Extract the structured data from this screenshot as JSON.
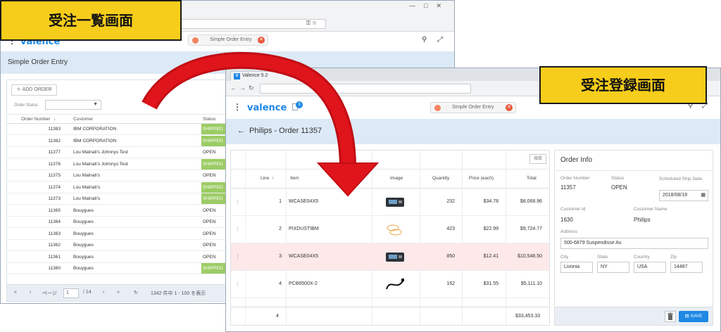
{
  "callouts": {
    "list_screen": "受注一覧画面",
    "entry_screen": "受注登録画面"
  },
  "list_window": {
    "app_logo": "valence",
    "open_tab": "Simple Order Entry",
    "page_title": "Simple Order Entry",
    "add_order_label": "ADD ORDER",
    "filter_label": "Order Status",
    "columns": {
      "order_number": "Order Number",
      "customer": "Customer",
      "status": "Status"
    },
    "rows": [
      {
        "num": "11383",
        "cust": "IBM CORPORATION",
        "status": "SHIPPED"
      },
      {
        "num": "11382",
        "cust": "IBM CORPORATION",
        "status": "SHIPPED"
      },
      {
        "num": "11377",
        "cust": "Lou Malnati's Johnnys Test",
        "status": "OPEN"
      },
      {
        "num": "11376",
        "cust": "Lou Malnati's Johnnys Test",
        "status": "SHIPPED"
      },
      {
        "num": "11375",
        "cust": "Lou Malnati's",
        "status": "OPEN"
      },
      {
        "num": "11374",
        "cust": "Lou Malnati's",
        "status": "SHIPPED"
      },
      {
        "num": "11373",
        "cust": "Lou Malnati's",
        "status": "SHIPPED"
      },
      {
        "num": "11365",
        "cust": "Bouygues",
        "status": "OPEN"
      },
      {
        "num": "11364",
        "cust": "Bouygues",
        "status": "OPEN"
      },
      {
        "num": "11363",
        "cust": "Bouygues",
        "status": "OPEN"
      },
      {
        "num": "11362",
        "cust": "Bouygues",
        "status": "OPEN"
      },
      {
        "num": "11361",
        "cust": "Bouygues",
        "status": "OPEN"
      },
      {
        "num": "11360",
        "cust": "Bouygues",
        "status": "SHIPPED"
      }
    ],
    "pager": {
      "page_label": "ページ",
      "page": "1",
      "of_pages": "/ 14",
      "summary": "1342 件中 1 - 100 を表示"
    }
  },
  "entry_window": {
    "browser_tab": "Valence 5.2",
    "app_logo": "valence",
    "badge_count": "3",
    "open_tab": "Simple Order Entry",
    "page_title": "Philips - Order 11357",
    "columns_button": "項目",
    "columns": {
      "line": "Line",
      "item": "Item",
      "image": "Image",
      "quantity": "Quantity",
      "price": "Price (each)",
      "total": "Total"
    },
    "lines": [
      {
        "line": "1",
        "item": "WCASE04X5",
        "qty": "232",
        "price": "$34.78",
        "total": "$8,068.96",
        "img": "device"
      },
      {
        "line": "2",
        "item": "PIXDUSTIBM",
        "qty": "423",
        "price": "$22.99",
        "total": "$9,724.77",
        "img": "rings"
      },
      {
        "line": "3",
        "item": "WCASE04X5",
        "qty": "850",
        "price": "$12.41",
        "total": "$10,548.50",
        "img": "device"
      },
      {
        "line": "4",
        "item": "PCB6500X-2",
        "qty": "162",
        "price": "$31.55",
        "total": "$5,111.10",
        "img": "cable"
      }
    ],
    "footer": {
      "line_count": "4",
      "grand_total": "$33,453.33"
    },
    "info": {
      "title": "Order Info",
      "order_number_label": "Order Number",
      "order_number": "11357",
      "status_label": "Status",
      "status": "OPEN",
      "ship_date_label": "Scheduled Ship Date",
      "ship_date": "2018/08/19",
      "customer_id_label": "Customer Id",
      "customer_id": "1630",
      "customer_name_label": "Customer Name",
      "customer_name": "Philips",
      "address_label": "Address",
      "address": "500-6879 Suspendisse Av.",
      "city_label": "City",
      "city": "Livonia",
      "state_label": "State",
      "state": "NY",
      "country_label": "Country",
      "country": "USA",
      "zip_label": "Zip",
      "zip": "14487",
      "save_label": "SAVE"
    }
  },
  "colors": {
    "accent": "#1e88e5",
    "callout": "#f7cd1b",
    "arrow": "#e0141b",
    "shipped": "#9ccc65",
    "highlight_row": "#fde8ea"
  }
}
